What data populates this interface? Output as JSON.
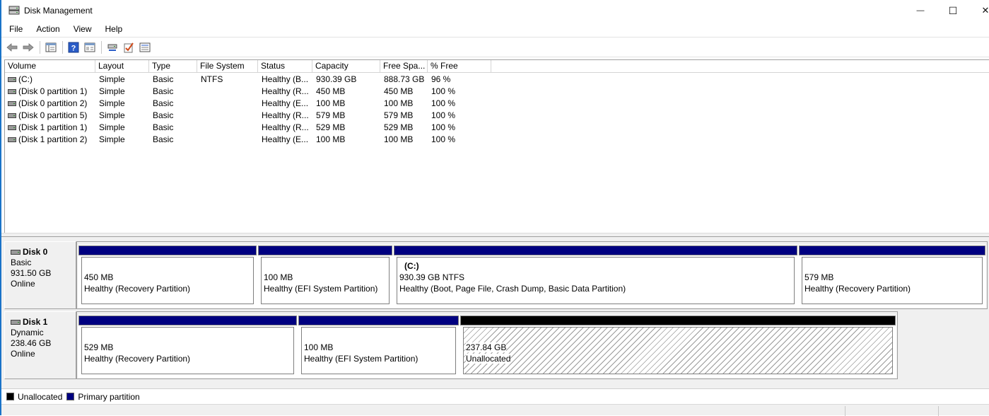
{
  "window": {
    "title": "Disk Management",
    "minimize_glyph": "—",
    "maximize_glyph": "☐",
    "close_glyph": "✕"
  },
  "menu": [
    "File",
    "Action",
    "View",
    "Help"
  ],
  "toolbar": {
    "icons": [
      "back-arrow-icon",
      "forward-arrow-icon",
      "show-hide-console-tree-icon",
      "help-icon",
      "properties-icon",
      "connect-disk-icon",
      "check-icon",
      "list-view-icon"
    ]
  },
  "volume_list": {
    "columns": [
      "Volume",
      "Layout",
      "Type",
      "File System",
      "Status",
      "Capacity",
      "Free Spa...",
      "% Free"
    ],
    "rows": [
      {
        "volume": "(C:)",
        "layout": "Simple",
        "type": "Basic",
        "fs": "NTFS",
        "status": "Healthy (B...",
        "capacity": "930.39 GB",
        "free": "888.73 GB",
        "pct": "96 %"
      },
      {
        "volume": "(Disk 0 partition 1)",
        "layout": "Simple",
        "type": "Basic",
        "fs": "",
        "status": "Healthy (R...",
        "capacity": "450 MB",
        "free": "450 MB",
        "pct": "100 %"
      },
      {
        "volume": "(Disk 0 partition 2)",
        "layout": "Simple",
        "type": "Basic",
        "fs": "",
        "status": "Healthy (E...",
        "capacity": "100 MB",
        "free": "100 MB",
        "pct": "100 %"
      },
      {
        "volume": "(Disk 0 partition 5)",
        "layout": "Simple",
        "type": "Basic",
        "fs": "",
        "status": "Healthy (R...",
        "capacity": "579 MB",
        "free": "579 MB",
        "pct": "100 %"
      },
      {
        "volume": "(Disk 1 partition 1)",
        "layout": "Simple",
        "type": "Basic",
        "fs": "",
        "status": "Healthy (R...",
        "capacity": "529 MB",
        "free": "529 MB",
        "pct": "100 %"
      },
      {
        "volume": "(Disk 1 partition 2)",
        "layout": "Simple",
        "type": "Basic",
        "fs": "",
        "status": "Healthy (E...",
        "capacity": "100 MB",
        "free": "100 MB",
        "pct": "100 %"
      }
    ]
  },
  "disks": [
    {
      "name": "Disk 0",
      "type": "Basic",
      "size": "931.50 GB",
      "state": "Online",
      "partitions": [
        {
          "size": "450 MB",
          "status": "Healthy (Recovery Partition)",
          "kind": "primary"
        },
        {
          "size": "100 MB",
          "status": "Healthy (EFI System Partition)",
          "kind": "primary"
        },
        {
          "label": "(C:)",
          "size": "930.39 GB NTFS",
          "status": "Healthy (Boot, Page File, Crash Dump, Basic Data Partition)",
          "kind": "primary"
        },
        {
          "size": "579 MB",
          "status": "Healthy (Recovery Partition)",
          "kind": "primary"
        }
      ]
    },
    {
      "name": "Disk 1",
      "type": "Dynamic",
      "size": "238.46 GB",
      "state": "Online",
      "partitions": [
        {
          "size": "529 MB",
          "status": "Healthy (Recovery Partition)",
          "kind": "primary"
        },
        {
          "size": "100 MB",
          "status": "Healthy (EFI System Partition)",
          "kind": "primary"
        },
        {
          "size": "237.84 GB",
          "status": "Unallocated",
          "kind": "unallocated"
        }
      ]
    }
  ],
  "legend": [
    {
      "label": "Unallocated",
      "color": "#000000"
    },
    {
      "label": "Primary partition",
      "color": "#000080"
    }
  ]
}
